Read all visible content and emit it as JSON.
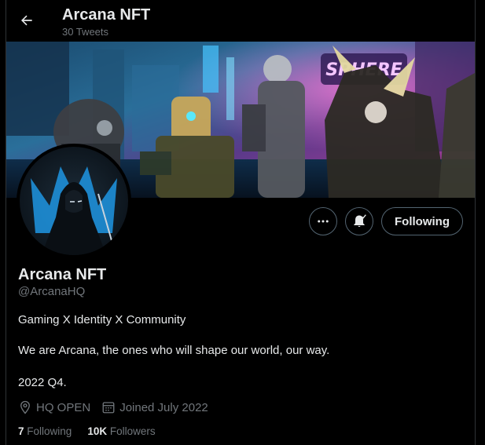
{
  "header": {
    "title": "Arcana NFT",
    "tweet_count": "30 Tweets"
  },
  "banner": {
    "sign_text": "SPHERE"
  },
  "actions": {
    "follow_label": "Following"
  },
  "profile": {
    "name": "Arcana NFT",
    "handle": "@ArcanaHQ",
    "bio_lines": [
      "Gaming X Identity X Community",
      "We are Arcana, the ones who will shape our world, our way.",
      "2022 Q4."
    ],
    "location": "HQ OPEN",
    "joined": "Joined July 2022"
  },
  "stats": {
    "following_count": "7",
    "following_label": "Following",
    "followers_count": "10K",
    "followers_label": "Followers"
  },
  "colors": {
    "background": "#000000",
    "text_primary": "#e7e9ea",
    "text_secondary": "#71767b",
    "border": "#536471"
  }
}
